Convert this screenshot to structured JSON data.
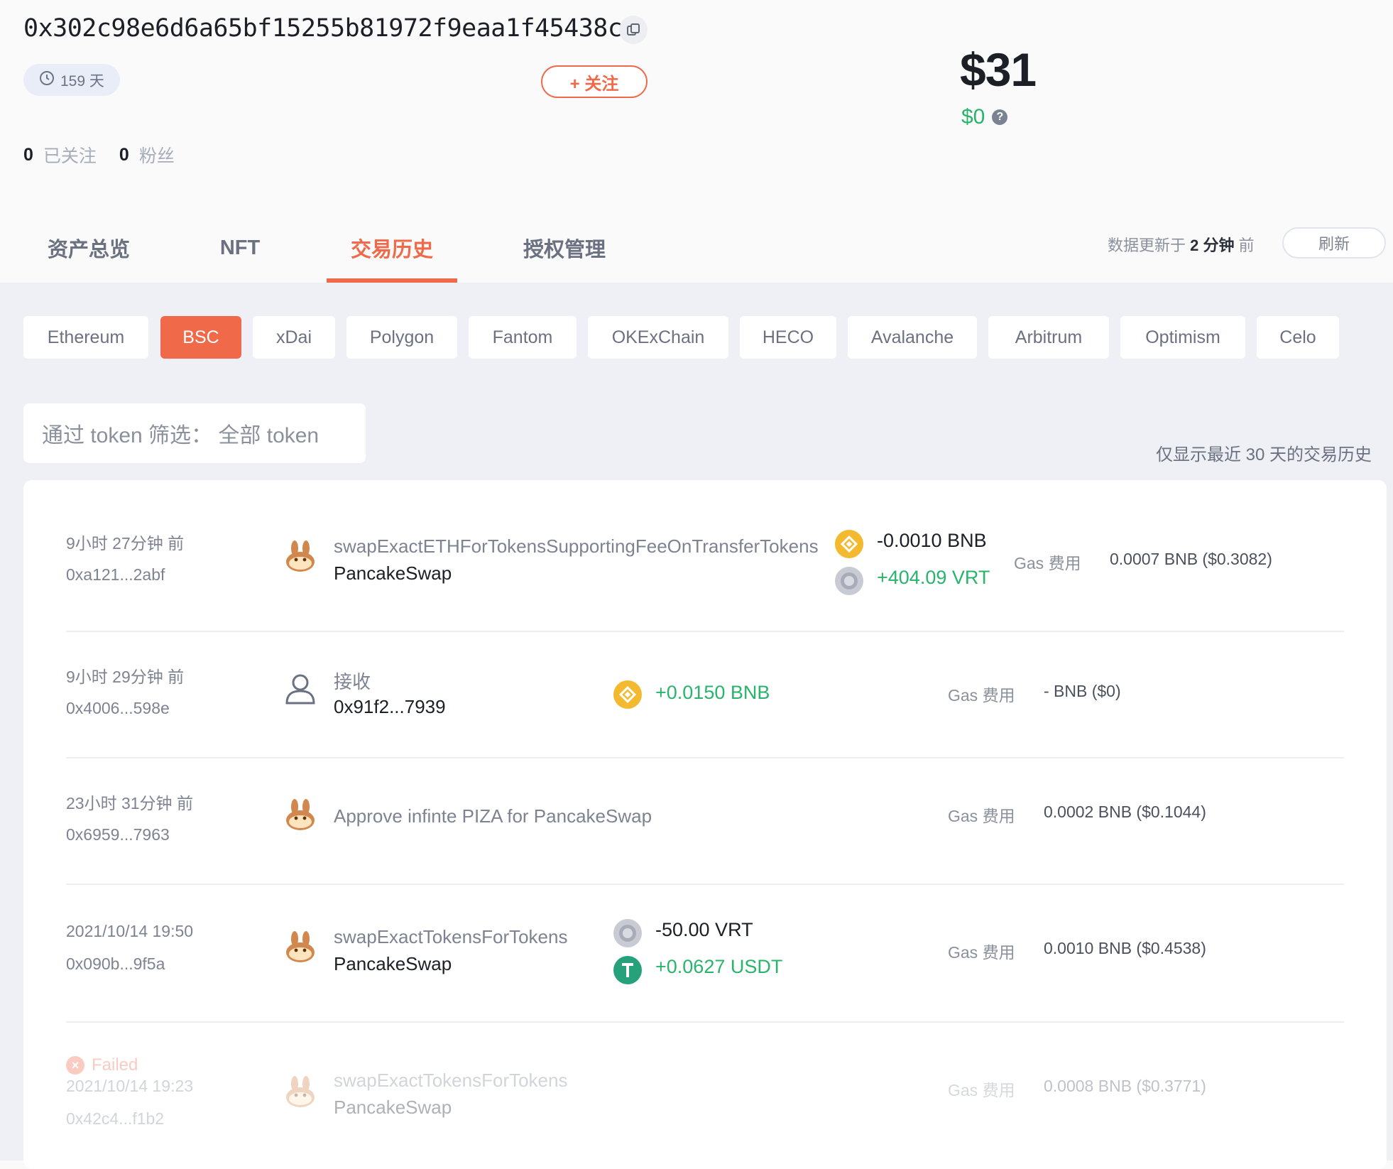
{
  "header": {
    "address": "0x302c98e6d6a65bf15255b81972f9eaa1f45438c8",
    "days": "159 天",
    "follow_button": "+ 关注",
    "total_usd": "$31",
    "change_usd": "$0",
    "following_count": "0",
    "following_label": "已关注",
    "followers_count": "0",
    "followers_label": "粉丝"
  },
  "tabs": [
    "资产总览",
    "NFT",
    "交易历史",
    "授权管理"
  ],
  "active_tab": "交易历史",
  "updated": {
    "prefix": "数据更新于",
    "value": "2 分钟",
    "suffix": "前"
  },
  "refresh_label": "刷新",
  "chains": [
    "Ethereum",
    "BSC",
    "xDai",
    "Polygon",
    "Fantom",
    "OKExChain",
    "HECO",
    "Avalanche",
    "Arbitrum",
    "Optimism",
    "Celo"
  ],
  "active_chain": "BSC",
  "filter_label": "通过 token 筛选： 全部 token",
  "note": "仅显示最近 30 天的交易历史",
  "gas_label": "Gas 费用",
  "transactions": [
    {
      "time": "9小时 27分钟 前",
      "hash": "0xa121...2abf",
      "icon": "pancakeswap-icon",
      "method": "swapExactETHForTokensSupportingFeeOnTransferTokens",
      "protocol": "PancakeSwap",
      "amounts": [
        {
          "token_icon": "bnb-icon",
          "text": "-0.0010 BNB",
          "sign": "neg"
        },
        {
          "token_icon": "vrt-icon",
          "text": "+404.09 VRT",
          "sign": "pos"
        }
      ],
      "gas": "0.0007 BNB ($0.3082)"
    },
    {
      "time": "9小时 29分钟 前",
      "hash": "0x4006...598e",
      "icon": "user-icon",
      "method": "接收",
      "protocol": "0x91f2...7939",
      "amounts": [
        {
          "token_icon": "bnb-icon",
          "text": "+0.0150 BNB",
          "sign": "pos"
        }
      ],
      "gas": "- BNB ($0)"
    },
    {
      "time": "23小时 31分钟 前",
      "hash": "0x6959...7963",
      "icon": "pancakeswap-icon",
      "method": "Approve infinte PIZA for PancakeSwap",
      "protocol": "",
      "amounts": [],
      "gas": "0.0002 BNB ($0.1044)"
    },
    {
      "time": "2021/10/14 19:50",
      "hash": "0x090b...9f5a",
      "icon": "pancakeswap-icon",
      "method": "swapExactTokensForTokens",
      "protocol": "PancakeSwap",
      "amounts": [
        {
          "token_icon": "vrt-icon",
          "text": "-50.00 VRT",
          "sign": "neg"
        },
        {
          "token_icon": "usdt-icon",
          "text": "+0.0627 USDT",
          "sign": "pos"
        }
      ],
      "gas": "0.0010 BNB ($0.4538)"
    },
    {
      "status": "Failed",
      "time": "2021/10/14 19:23",
      "hash": "0x42c4...f1b2",
      "icon": "pancakeswap-icon",
      "method": "swapExactTokensForTokens",
      "protocol": "PancakeSwap",
      "amounts": [],
      "gas": "0.0008 BNB ($0.3771)"
    }
  ],
  "colors": {
    "accent": "#f06a4a",
    "positive": "#28b46b",
    "bnb": "#f3ba2f",
    "usdt": "#26a17b"
  }
}
